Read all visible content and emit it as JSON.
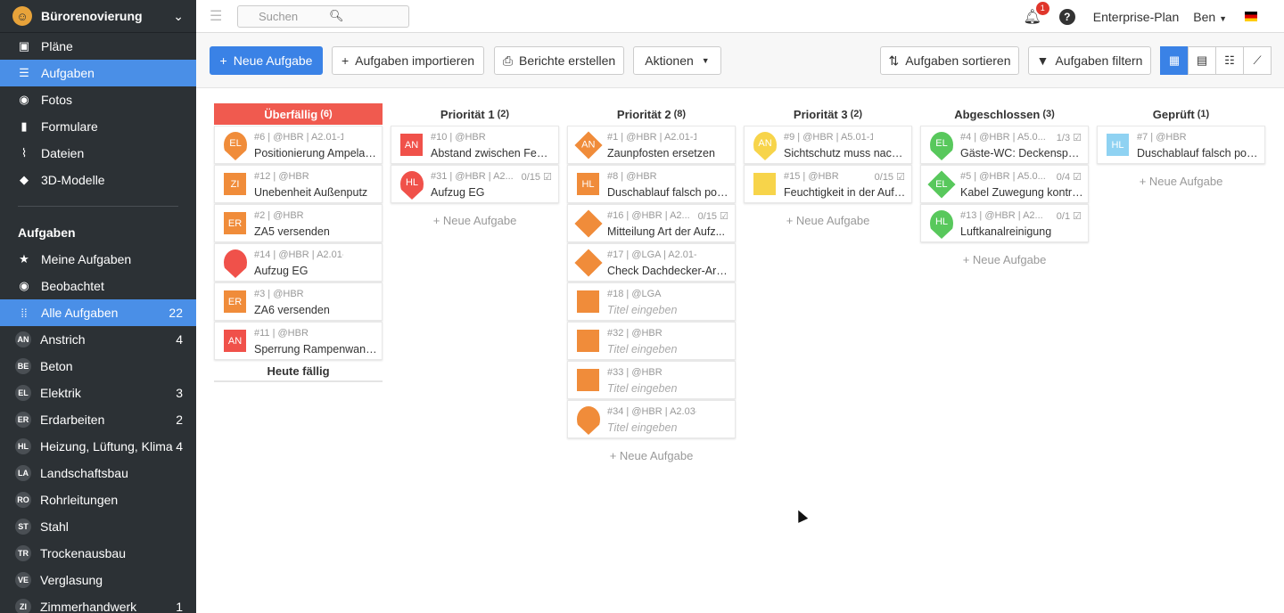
{
  "project": "Bürorenovierung",
  "nav_main": [
    {
      "icon": "plans-icon",
      "label": "Pläne"
    },
    {
      "icon": "list-icon",
      "label": "Aufgaben",
      "active": true
    },
    {
      "icon": "camera-icon",
      "label": "Fotos"
    },
    {
      "icon": "clipboard-icon",
      "label": "Formulare"
    },
    {
      "icon": "paperclip-icon",
      "label": "Dateien"
    },
    {
      "icon": "cube-icon",
      "label": "3D-Modelle"
    }
  ],
  "tasks_section": "Aufgaben",
  "nav_tasks": [
    {
      "badge": "",
      "icon": "star-icon",
      "label": "Meine Aufgaben",
      "count": ""
    },
    {
      "badge": "",
      "icon": "eye-icon",
      "label": "Beobachtet",
      "count": ""
    },
    {
      "badge": "",
      "icon": "grid-icon",
      "label": "Alle Aufgaben",
      "count": "22",
      "active": true
    },
    {
      "badge": "AN",
      "label": "Anstrich",
      "count": "4"
    },
    {
      "badge": "BE",
      "label": "Beton",
      "count": ""
    },
    {
      "badge": "EL",
      "label": "Elektrik",
      "count": "3"
    },
    {
      "badge": "ER",
      "label": "Erdarbeiten",
      "count": "2"
    },
    {
      "badge": "HL",
      "label": "Heizung, Lüftung, Klima",
      "count": "4"
    },
    {
      "badge": "LA",
      "label": "Landschaftsbau",
      "count": ""
    },
    {
      "badge": "RO",
      "label": "Rohrleitungen",
      "count": ""
    },
    {
      "badge": "ST",
      "label": "Stahl",
      "count": ""
    },
    {
      "badge": "TR",
      "label": "Trockenausbau",
      "count": ""
    },
    {
      "badge": "VE",
      "label": "Verglasung",
      "count": ""
    },
    {
      "badge": "ZI",
      "label": "Zimmerhandwerk",
      "count": "1"
    }
  ],
  "search": {
    "placeholder": "Suchen"
  },
  "notifications": "1",
  "help": "?",
  "plan": "Enterprise-Plan",
  "user": "Ben",
  "toolbar": {
    "new_task": "Neue Aufgabe",
    "import": "Aufgaben importieren",
    "reports": "Berichte erstellen",
    "actions": "Aktionen",
    "sort": "Aufgaben sortieren",
    "filter": "Aufgaben filtern"
  },
  "new_task_link": "+ Neue Aufgabe",
  "today_due": "Heute fällig",
  "columns": [
    {
      "title": "Überfällig",
      "count": "(6)",
      "overdue": true,
      "new_link": false,
      "cards": [
        {
          "shape": "pin",
          "color": "#f08c3a",
          "badge": "EL",
          "meta": "#6 | @HBR | A2.01-1",
          "progress": "",
          "title": "Positionierung Ampelan..."
        },
        {
          "shape": "sq",
          "color": "#f08c3a",
          "badge": "ZI",
          "meta": "#12 | @HBR",
          "progress": "",
          "title": "Unebenheit Außenputz"
        },
        {
          "shape": "sq",
          "color": "#f08c3a",
          "badge": "ER",
          "meta": "#2 | @HBR",
          "progress": "",
          "title": "ZA5 versenden"
        },
        {
          "shape": "pin",
          "color": "#f0514a",
          "badge": "",
          "meta": "#14 | @HBR | A2.01-1",
          "progress": "",
          "title": "Aufzug EG"
        },
        {
          "shape": "sq",
          "color": "#f08c3a",
          "badge": "ER",
          "meta": "#3 | @HBR",
          "progress": "",
          "title": "ZA6 versenden"
        },
        {
          "shape": "sq",
          "color": "#f0514a",
          "badge": "AN",
          "meta": "#11 | @HBR",
          "progress": "",
          "title": "Sperrung Rampenwand/..."
        }
      ]
    },
    {
      "title": "Priorität 1",
      "count": "(2)",
      "new_link": true,
      "cards": [
        {
          "shape": "sq",
          "color": "#f0514a",
          "badge": "AN",
          "meta": "#10 | @HBR",
          "progress": "",
          "title": "Abstand zwischen Fenst..."
        },
        {
          "shape": "pin",
          "color": "#f0514a",
          "badge": "HL",
          "meta": "#31 | @HBR | A2...",
          "progress": "0/15",
          "title": "Aufzug EG"
        }
      ]
    },
    {
      "title": "Priorität 2",
      "count": "(8)",
      "new_link": true,
      "cards": [
        {
          "shape": "dia",
          "color": "#f08c3a",
          "badge": "AN",
          "meta": "#1 | @HBR | A2.01-1",
          "progress": "",
          "title": "Zaunpfosten ersetzen"
        },
        {
          "shape": "sq",
          "color": "#f08c3a",
          "badge": "HL",
          "meta": "#8 | @HBR",
          "progress": "",
          "title": "Duschablauf falsch posit..."
        },
        {
          "shape": "dia",
          "color": "#f08c3a",
          "badge": "",
          "meta": "#16 | @HBR | A2...",
          "progress": "0/15",
          "title": "Mitteilung Art der Aufz..."
        },
        {
          "shape": "dia",
          "color": "#f08c3a",
          "badge": "",
          "meta": "#17 | @LGA | A2.01-1",
          "progress": "",
          "title": "Check Dachdecker-Arb..."
        },
        {
          "shape": "sq",
          "color": "#f08c3a",
          "badge": "",
          "meta": "#18 | @LGA",
          "progress": "",
          "title": "Titel eingeben",
          "placeholder": true
        },
        {
          "shape": "sq",
          "color": "#f08c3a",
          "badge": "",
          "meta": "#32 | @HBR",
          "progress": "",
          "title": "Titel eingeben",
          "placeholder": true
        },
        {
          "shape": "sq",
          "color": "#f08c3a",
          "badge": "",
          "meta": "#33 | @HBR",
          "progress": "",
          "title": "Titel eingeben",
          "placeholder": true
        },
        {
          "shape": "pin",
          "color": "#f08c3a",
          "badge": "",
          "meta": "#34 | @HBR | A2.03-1",
          "progress": "",
          "title": "Titel eingeben",
          "placeholder": true
        }
      ]
    },
    {
      "title": "Priorität 3",
      "count": "(2)",
      "new_link": true,
      "cards": [
        {
          "shape": "pin",
          "color": "#f7d44a",
          "badge": "AN",
          "meta": "#9 | @HBR | A5.01-1",
          "progress": "",
          "title": "Sichtschutz muss nachla..."
        },
        {
          "shape": "sq",
          "color": "#f7d44a",
          "badge": "",
          "meta": "#15 | @HBR",
          "progress": "0/15",
          "title": "Feuchtigkeit in der Aufz..."
        }
      ]
    },
    {
      "title": "Abgeschlossen",
      "count": "(3)",
      "new_link": true,
      "cards": [
        {
          "shape": "pin",
          "color": "#58c85c",
          "badge": "EL",
          "meta": "#4 | @HBR | A5.0...",
          "progress": "1/3",
          "title": "Gäste-WC: Deckenspot ..."
        },
        {
          "shape": "dia",
          "color": "#58c85c",
          "badge": "EL",
          "meta": "#5 | @HBR | A5.0...",
          "progress": "0/4",
          "title": "Kabel Zuwegung kontro..."
        },
        {
          "shape": "pin",
          "color": "#58c85c",
          "badge": "HL",
          "meta": "#13 | @HBR | A2...",
          "progress": "0/1",
          "title": "Luftkanalreinigung"
        }
      ]
    },
    {
      "title": "Geprüft",
      "count": "(1)",
      "new_link": true,
      "cards": [
        {
          "shape": "sq",
          "color": "#8fd2f2",
          "badge": "HL",
          "meta": "#7 | @HBR",
          "progress": "",
          "title": "Duschablauf falsch posit..."
        }
      ]
    }
  ]
}
